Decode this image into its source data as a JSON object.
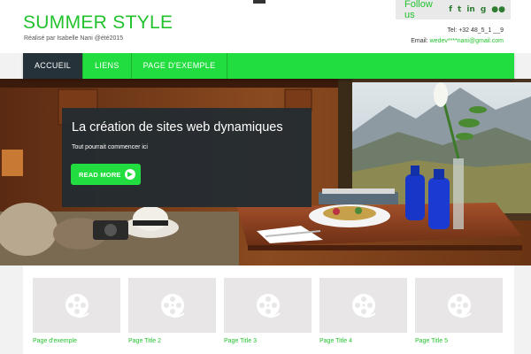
{
  "header": {
    "site_title": "SUMMER STYLE",
    "subtitle": "Réalisé par Isabelle Nani @été2015",
    "follow_label": "Follow us",
    "social_icons": [
      {
        "name": "facebook-icon",
        "glyph": "f"
      },
      {
        "name": "twitter-icon",
        "glyph": "t"
      },
      {
        "name": "linkedin-icon",
        "glyph": "in"
      },
      {
        "name": "google-plus-icon",
        "glyph": "g"
      },
      {
        "name": "flickr-icon",
        "glyph": "●●"
      }
    ],
    "tel_label": "Tel:",
    "tel_value": "+32 48_5_1 __9",
    "email_label": "Email:",
    "email_value": "wedev****nani@gmail.com"
  },
  "nav": {
    "items": [
      {
        "label": "ACCUEIL",
        "active": true
      },
      {
        "label": "LIENS",
        "active": false
      },
      {
        "label": "PAGE D'EXEMPLE",
        "active": false
      }
    ]
  },
  "hero": {
    "title": "La création de sites web dynamiques",
    "text": "Tout pourrait commencer ici",
    "button_label": "READ MORE"
  },
  "gallery": {
    "items": [
      {
        "title": "Page d'exemple"
      },
      {
        "title": "Page Title 2"
      },
      {
        "title": "Page Title 3"
      },
      {
        "title": "Page Title 4"
      },
      {
        "title": "Page Title 5"
      }
    ]
  },
  "colors": {
    "accent_green": "#22dd3f",
    "title_green": "#22c22e",
    "nav_active": "#26323a",
    "hero_card": "#212b32"
  }
}
